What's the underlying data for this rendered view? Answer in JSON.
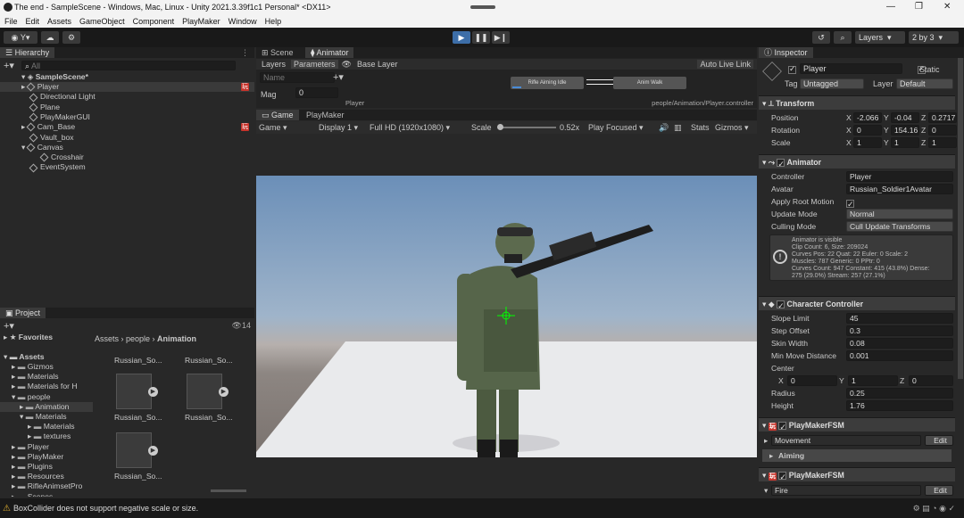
{
  "title": "The end - SampleScene - Windows, Mac, Linux - Unity 2021.3.39f1c1 Personal* <DX11>",
  "menu": [
    "File",
    "Edit",
    "Assets",
    "GameObject",
    "Component",
    "PlayMaker",
    "Window",
    "Help"
  ],
  "toolbar": {
    "account": "Y",
    "layers": "Layers",
    "layout": "2 by 3"
  },
  "hierarchy": {
    "tab": "Hierarchy",
    "search": "All",
    "scene": "SampleScene*",
    "items": [
      {
        "label": "Player",
        "indent": 1,
        "arrow": true,
        "selected": true,
        "fsm": true
      },
      {
        "label": "Directional Light",
        "indent": 1
      },
      {
        "label": "Plane",
        "indent": 1
      },
      {
        "label": "PlayMakerGUI",
        "indent": 1
      },
      {
        "label": "Cam_Base",
        "indent": 1,
        "arrow": true,
        "fsm": true
      },
      {
        "label": "Vault_box",
        "indent": 1
      },
      {
        "label": "Canvas",
        "indent": 1,
        "arrow": true,
        "open": true
      },
      {
        "label": "Crosshair",
        "indent": 2
      },
      {
        "label": "EventSystem",
        "indent": 1
      }
    ]
  },
  "project": {
    "tab": "Project",
    "count": "14",
    "favorites": "Favorites",
    "assets": "Assets",
    "tree": [
      {
        "label": "Gizmos",
        "indent": 1
      },
      {
        "label": "Materials",
        "indent": 1
      },
      {
        "label": "Materials for H",
        "indent": 1
      },
      {
        "label": "people",
        "indent": 1,
        "open": true
      },
      {
        "label": "Animation",
        "indent": 2,
        "selected": true
      },
      {
        "label": "Materials",
        "indent": 2,
        "open": true
      },
      {
        "label": "Materials",
        "indent": 3
      },
      {
        "label": "textures",
        "indent": 3
      },
      {
        "label": "Player",
        "indent": 1
      },
      {
        "label": "PlayMaker",
        "indent": 1
      },
      {
        "label": "Plugins",
        "indent": 1
      },
      {
        "label": "Resources",
        "indent": 1
      },
      {
        "label": "RifleAnimsetPro",
        "indent": 1
      },
      {
        "label": "Scenes",
        "indent": 1
      }
    ],
    "breadcrumb": [
      "Assets",
      "people",
      "Animation"
    ],
    "files": [
      "Russian_So...",
      "Russian_So...",
      "Russian_So...",
      "Russian_So...",
      "Russian_So..."
    ]
  },
  "scene_tabs": [
    "Scene",
    "Animator"
  ],
  "animator": {
    "tabs": [
      "Layers",
      "Parameters"
    ],
    "layer": "Base Layer",
    "live_link": "Auto Live Link",
    "search": "Name",
    "param": "Mag",
    "param_value": "0",
    "state1": "Rifle Aiming Idle",
    "state2": "Anim Walk",
    "footer_left": "Player",
    "footer_right": "people/Animation/Player.controller"
  },
  "game": {
    "tabs": [
      "Game",
      "PlayMaker"
    ],
    "mode": "Game",
    "display": "Display 1",
    "res": "Full HD (1920x1080)",
    "scale_label": "Scale",
    "scale_value": "0.52x",
    "focus": "Play Focused",
    "stats": "Stats",
    "gizmos": "Gizmos"
  },
  "inspector": {
    "tab": "Inspector",
    "name": "Player",
    "static": "Static",
    "tag_label": "Tag",
    "tag": "Untagged",
    "layer_label": "Layer",
    "layer": "Default",
    "transform": {
      "title": "Transform",
      "position": [
        "-2.066",
        "-0.04",
        "0.2717"
      ],
      "rotation": [
        "0",
        "154.16",
        "0"
      ],
      "scale": [
        "1",
        "1",
        "1"
      ],
      "labels": [
        "Position",
        "Rotation",
        "Scale"
      ]
    },
    "animator": {
      "title": "Animator",
      "controller_label": "Controller",
      "controller": "Player",
      "avatar_label": "Avatar",
      "avatar": "Russian_Soldier1Avatar",
      "root_motion": "Apply Root Motion",
      "update_label": "Update Mode",
      "update": "Normal",
      "culling_label": "Culling Mode",
      "culling": "Cull Update Transforms",
      "info": [
        "Animator is visible",
        "Clip Count: 6, Size: 209024",
        "Curves Pos: 22 Quat: 22 Euler: 0 Scale: 2",
        "Muscles: 787 Generic: 0 PPtr: 0",
        "Curves Count: 947 Constant: 415 (43.8%) Dense:",
        "275 (29.0%) Stream: 257 (27.1%)"
      ]
    },
    "cc": {
      "title": "Character Controller",
      "rows": [
        [
          "Slope Limit",
          "45"
        ],
        [
          "Step Offset",
          "0.3"
        ],
        [
          "Skin Width",
          "0.08"
        ],
        [
          "Min Move Distance",
          "0.001"
        ]
      ],
      "center": "Center",
      "cx": "0",
      "cy": "1",
      "cz": "0",
      "radius_label": "Radius",
      "radius": "0.25",
      "height_label": "Height",
      "height": "1.76"
    },
    "fsm1": {
      "title": "PlayMakerFSM",
      "state": "Movement",
      "edit": "Edit",
      "active": "Aiming"
    },
    "fsm2": {
      "title": "PlayMakerFSM",
      "state": "Fire",
      "edit": "Edit"
    }
  },
  "status": "BoxCollider does not support negative scale or size."
}
